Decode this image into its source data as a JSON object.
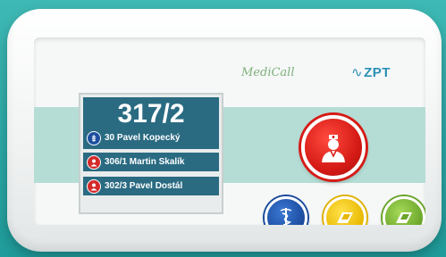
{
  "brand": {
    "product_name": "MediCall",
    "maker": "ZPT",
    "maker_mark": "∿"
  },
  "screen": {
    "room": "317/2",
    "calls": [
      {
        "label": "30 Pavel Kopecký",
        "icon": "caduceus-icon",
        "color": "#1d4fa0"
      },
      {
        "label": "306/1 Martin Skalík",
        "icon": "nurse-icon",
        "color": "#d42a2a"
      },
      {
        "label": "302/3 Pavel Dostál",
        "icon": "nurse-icon",
        "color": "#d42a2a"
      }
    ]
  },
  "buttons": {
    "nurse_call": {
      "icon": "nurse-icon",
      "color": "#d61b16"
    },
    "doctor": {
      "icon": "caduceus-icon",
      "color": "#1b4a9c"
    },
    "bed_yellow": {
      "icon": "bed-icon",
      "color": "#e8b800"
    },
    "bed_green": {
      "icon": "bed-icon",
      "color": "#6aa52b"
    }
  },
  "colors": {
    "background": "#2aa8a6",
    "band": "#b5dcd5",
    "screen_header": "#2a6b82"
  }
}
